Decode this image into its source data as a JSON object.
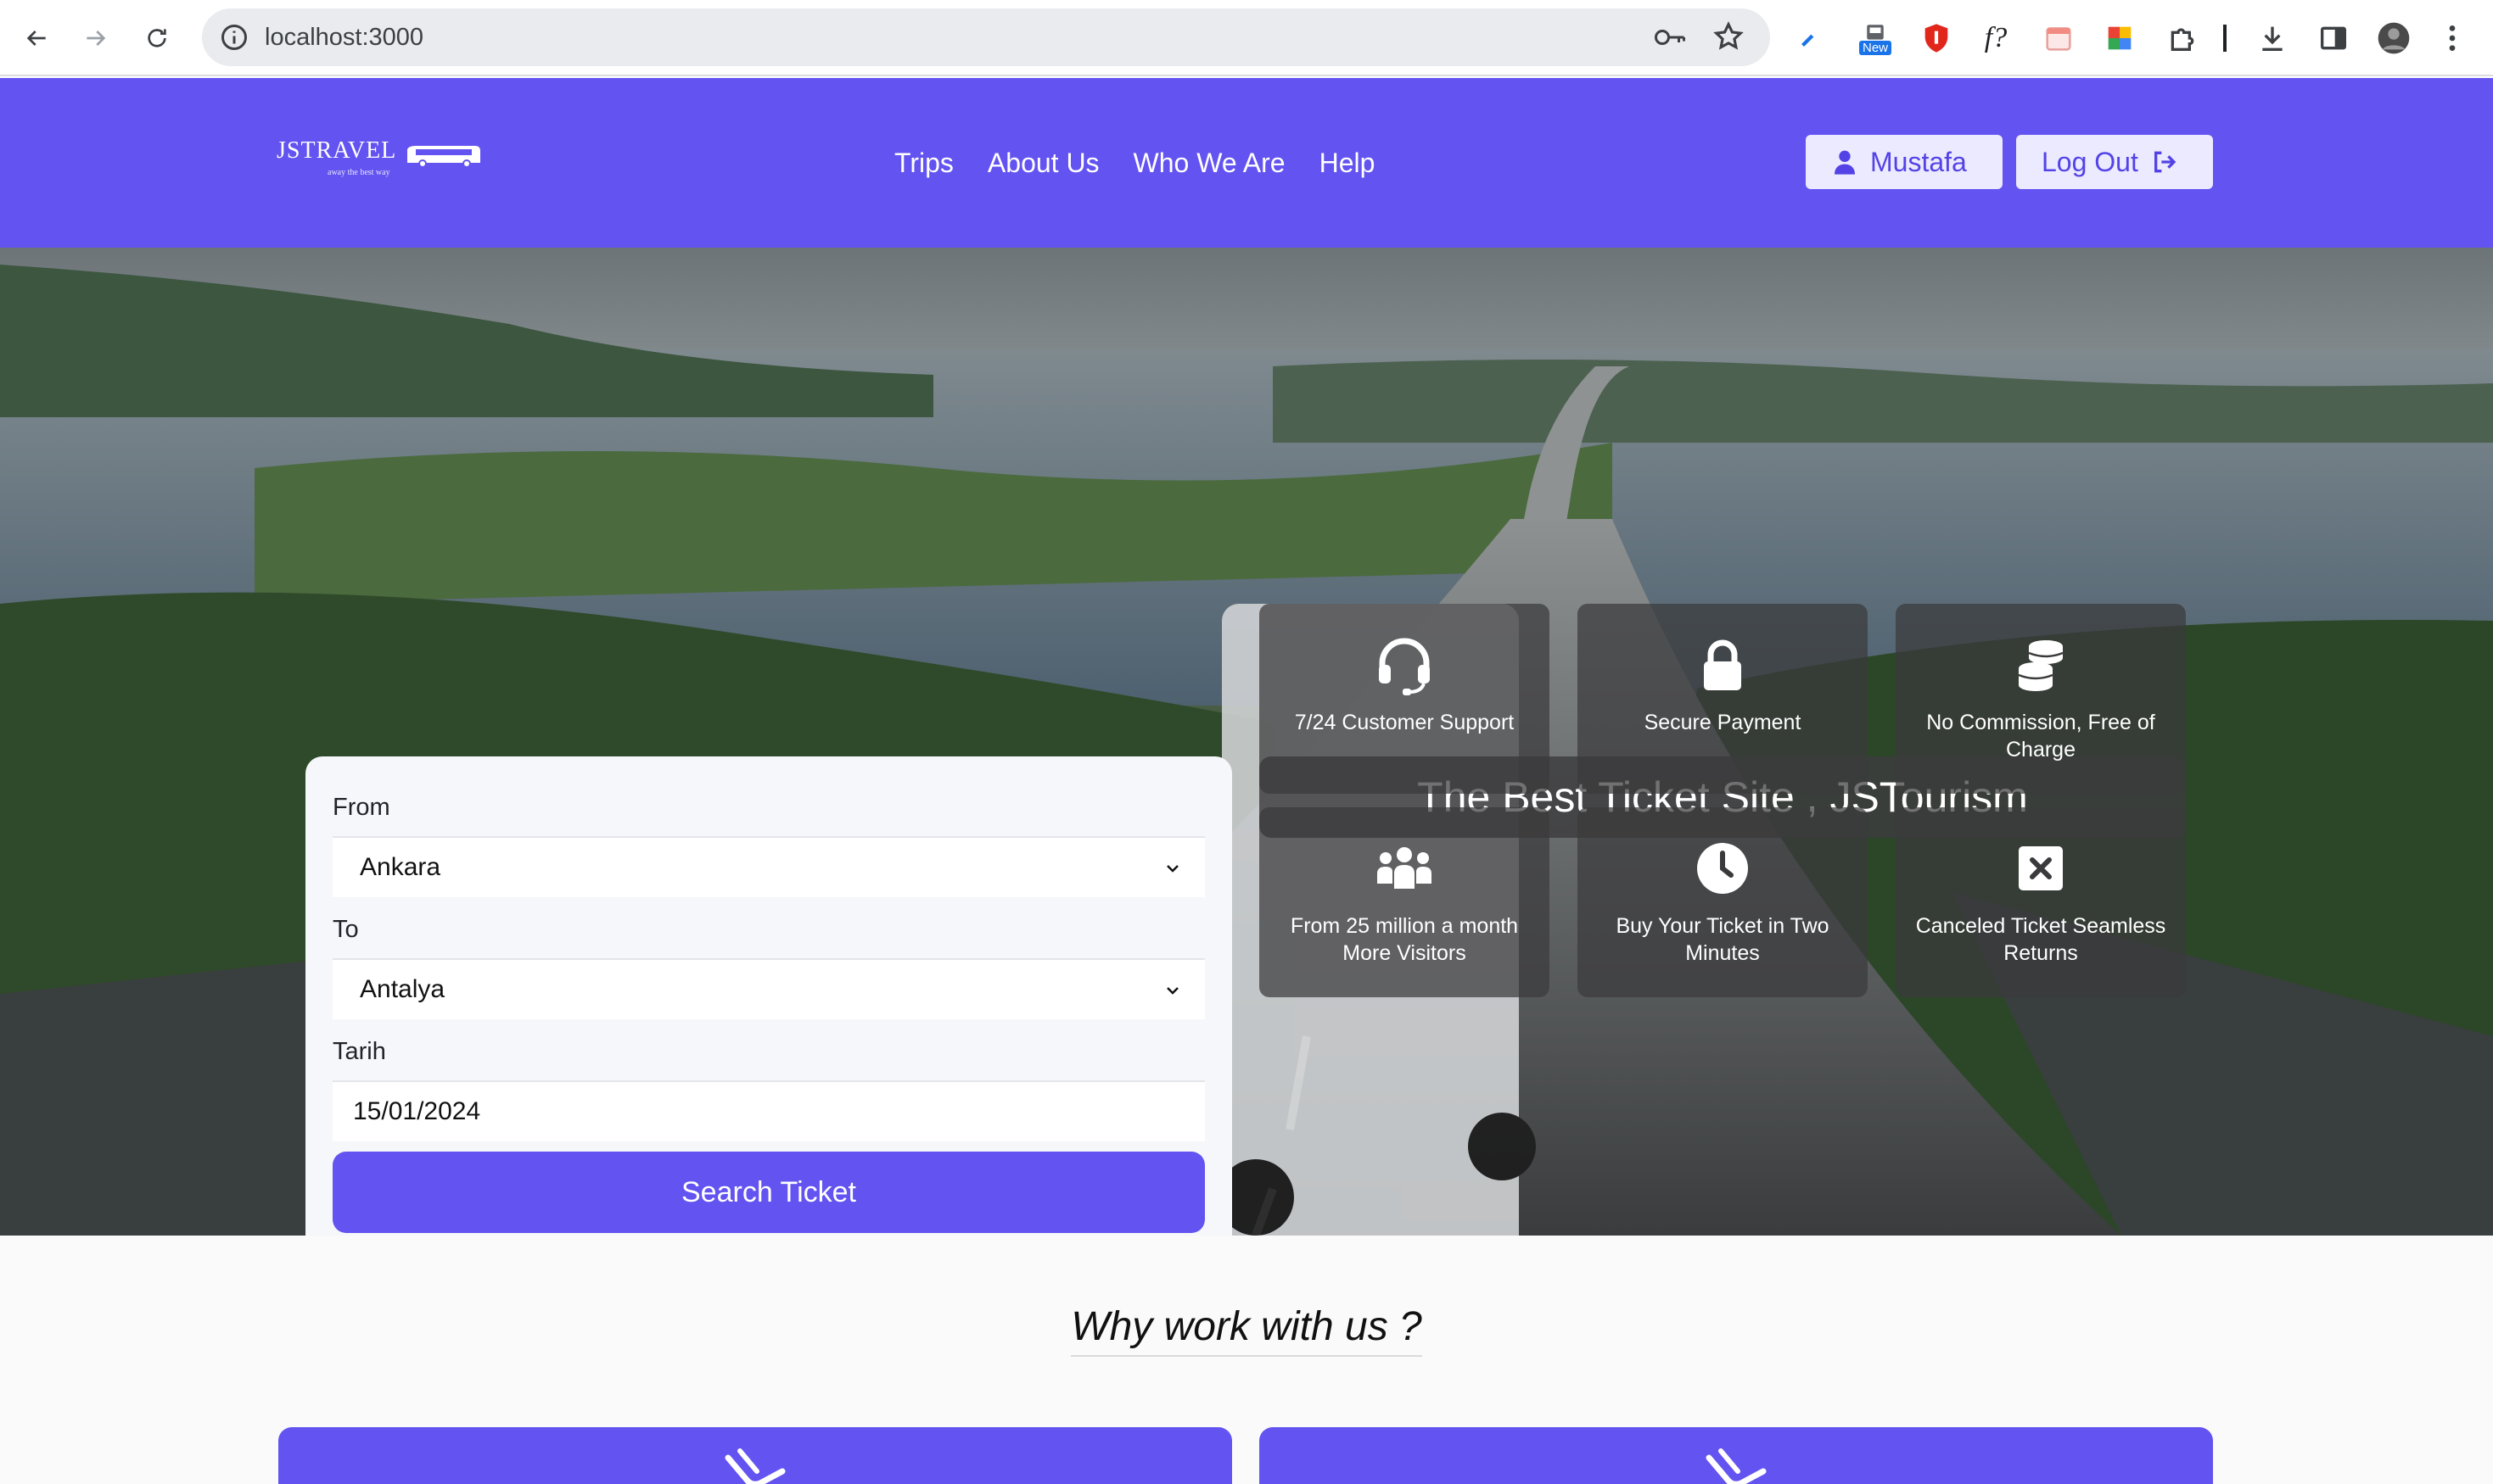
{
  "browser": {
    "url": "localhost:3000",
    "extension_badge": "New",
    "extension_script": "f?",
    "icons": [
      "back-icon",
      "forward-icon",
      "reload-icon",
      "info-icon",
      "key-icon",
      "star-icon",
      "pen-icon",
      "new-extension-icon",
      "shield-extension-icon",
      "function-extension-icon",
      "calendar-extension-icon",
      "color-extension-icon",
      "puzzle-icon",
      "download-icon",
      "sidebar-icon",
      "profile-avatar",
      "more-icon"
    ]
  },
  "header": {
    "brand": "JSTRAVEL",
    "tagline": "away the best way",
    "nav": [
      "Trips",
      "About Us",
      "Who We Are",
      "Help"
    ],
    "user_label": "Mustafa",
    "logout_label": "Log Out",
    "accent": "#6353f0"
  },
  "search": {
    "from_label": "From",
    "from_value": "Ankara",
    "to_label": "To",
    "to_value": "Antalya",
    "date_label": "Tarih",
    "date_value": "15/01/2024",
    "button_label": "Search Ticket"
  },
  "hero": {
    "title": "The Best Ticket Site , JSTourism",
    "features": [
      {
        "icon": "headset-icon",
        "text": "7/24 Customer Support"
      },
      {
        "icon": "lock-icon",
        "text": "Secure Payment"
      },
      {
        "icon": "coins-icon",
        "text": "No Commission, Free of Charge"
      },
      {
        "icon": "people-icon",
        "text": "From 25 million a month More Visitors"
      },
      {
        "icon": "clock-icon",
        "text": "Buy Your Ticket in Two Minutes"
      },
      {
        "icon": "x-square-icon",
        "text": "Canceled Ticket Seamless Returns"
      }
    ]
  },
  "section": {
    "why_title": "Why work with us ?"
  }
}
